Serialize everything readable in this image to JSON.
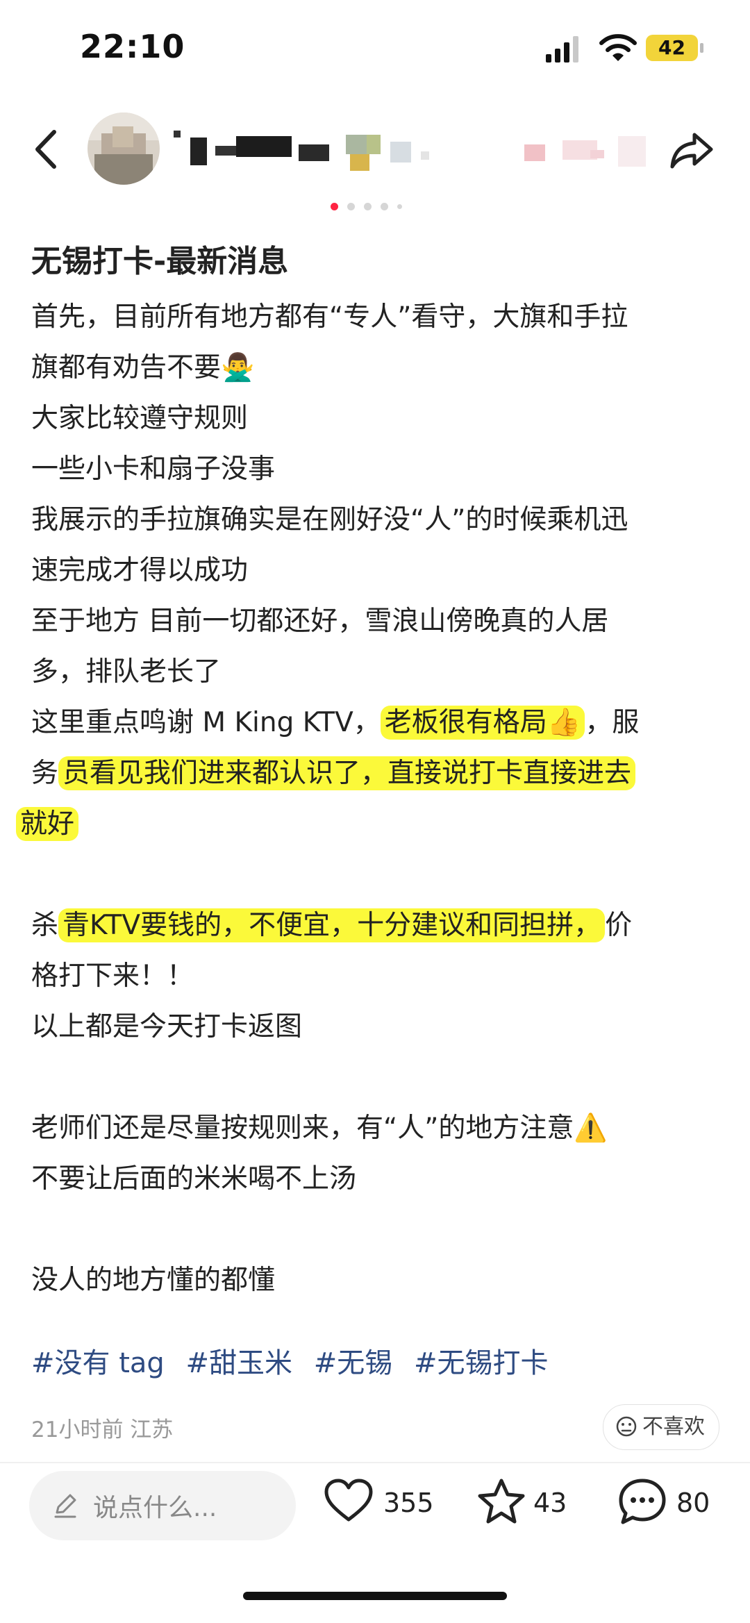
{
  "status_bar": {
    "time": "22:10",
    "battery": "42"
  },
  "post": {
    "title": "无锡打卡-最新消息",
    "lines": [
      "首先，目前所有地方都有“专人”看守，大旗和手拉",
      "旗都有劝告不要🙅‍♂️",
      "大家比较遵守规则",
      "一些小卡和扇子没事",
      "我展示的手拉旗确实是在刚好没“人”的时候乘机迅",
      "速完成才得以成功",
      "至于地方 目前一切都还好，雪浪山傍晚真的人居",
      "多，排队老长了"
    ],
    "l9a": "这里重点鸣谢 M King KTV，",
    "l9b": "老板很有格局👍",
    "l9c": "，服",
    "l10a": "务",
    "l10b": "员看见我们进来都认识了，直接说打卡直接进去",
    "l11": "就好",
    "l13a": "杀",
    "l13b": "青KTV要钱的，不便宜，十分建议和同担拼，",
    "l13c": "价",
    "l14": "格打下来！！",
    "l15": "以上都是今天打卡返图",
    "l17": "老师们还是尽量按规则来，有“人”的地方注意⚠️",
    "l18": "不要让后面的米米喝不上汤",
    "l20": "没人的地方懂的都懂",
    "tags": [
      "#没有 tag",
      "#甜玉米",
      "#无锡",
      "#无锡打卡"
    ],
    "meta": "21小时前 江苏",
    "dislike": "不喜欢"
  },
  "bottom_bar": {
    "comment_placeholder": "说点什么...",
    "likes": "355",
    "stars": "43",
    "comments": "80"
  },
  "colors": {
    "highlight": "#fbf93a",
    "tag": "#2e4b82",
    "active_dot": "#ff2442"
  }
}
